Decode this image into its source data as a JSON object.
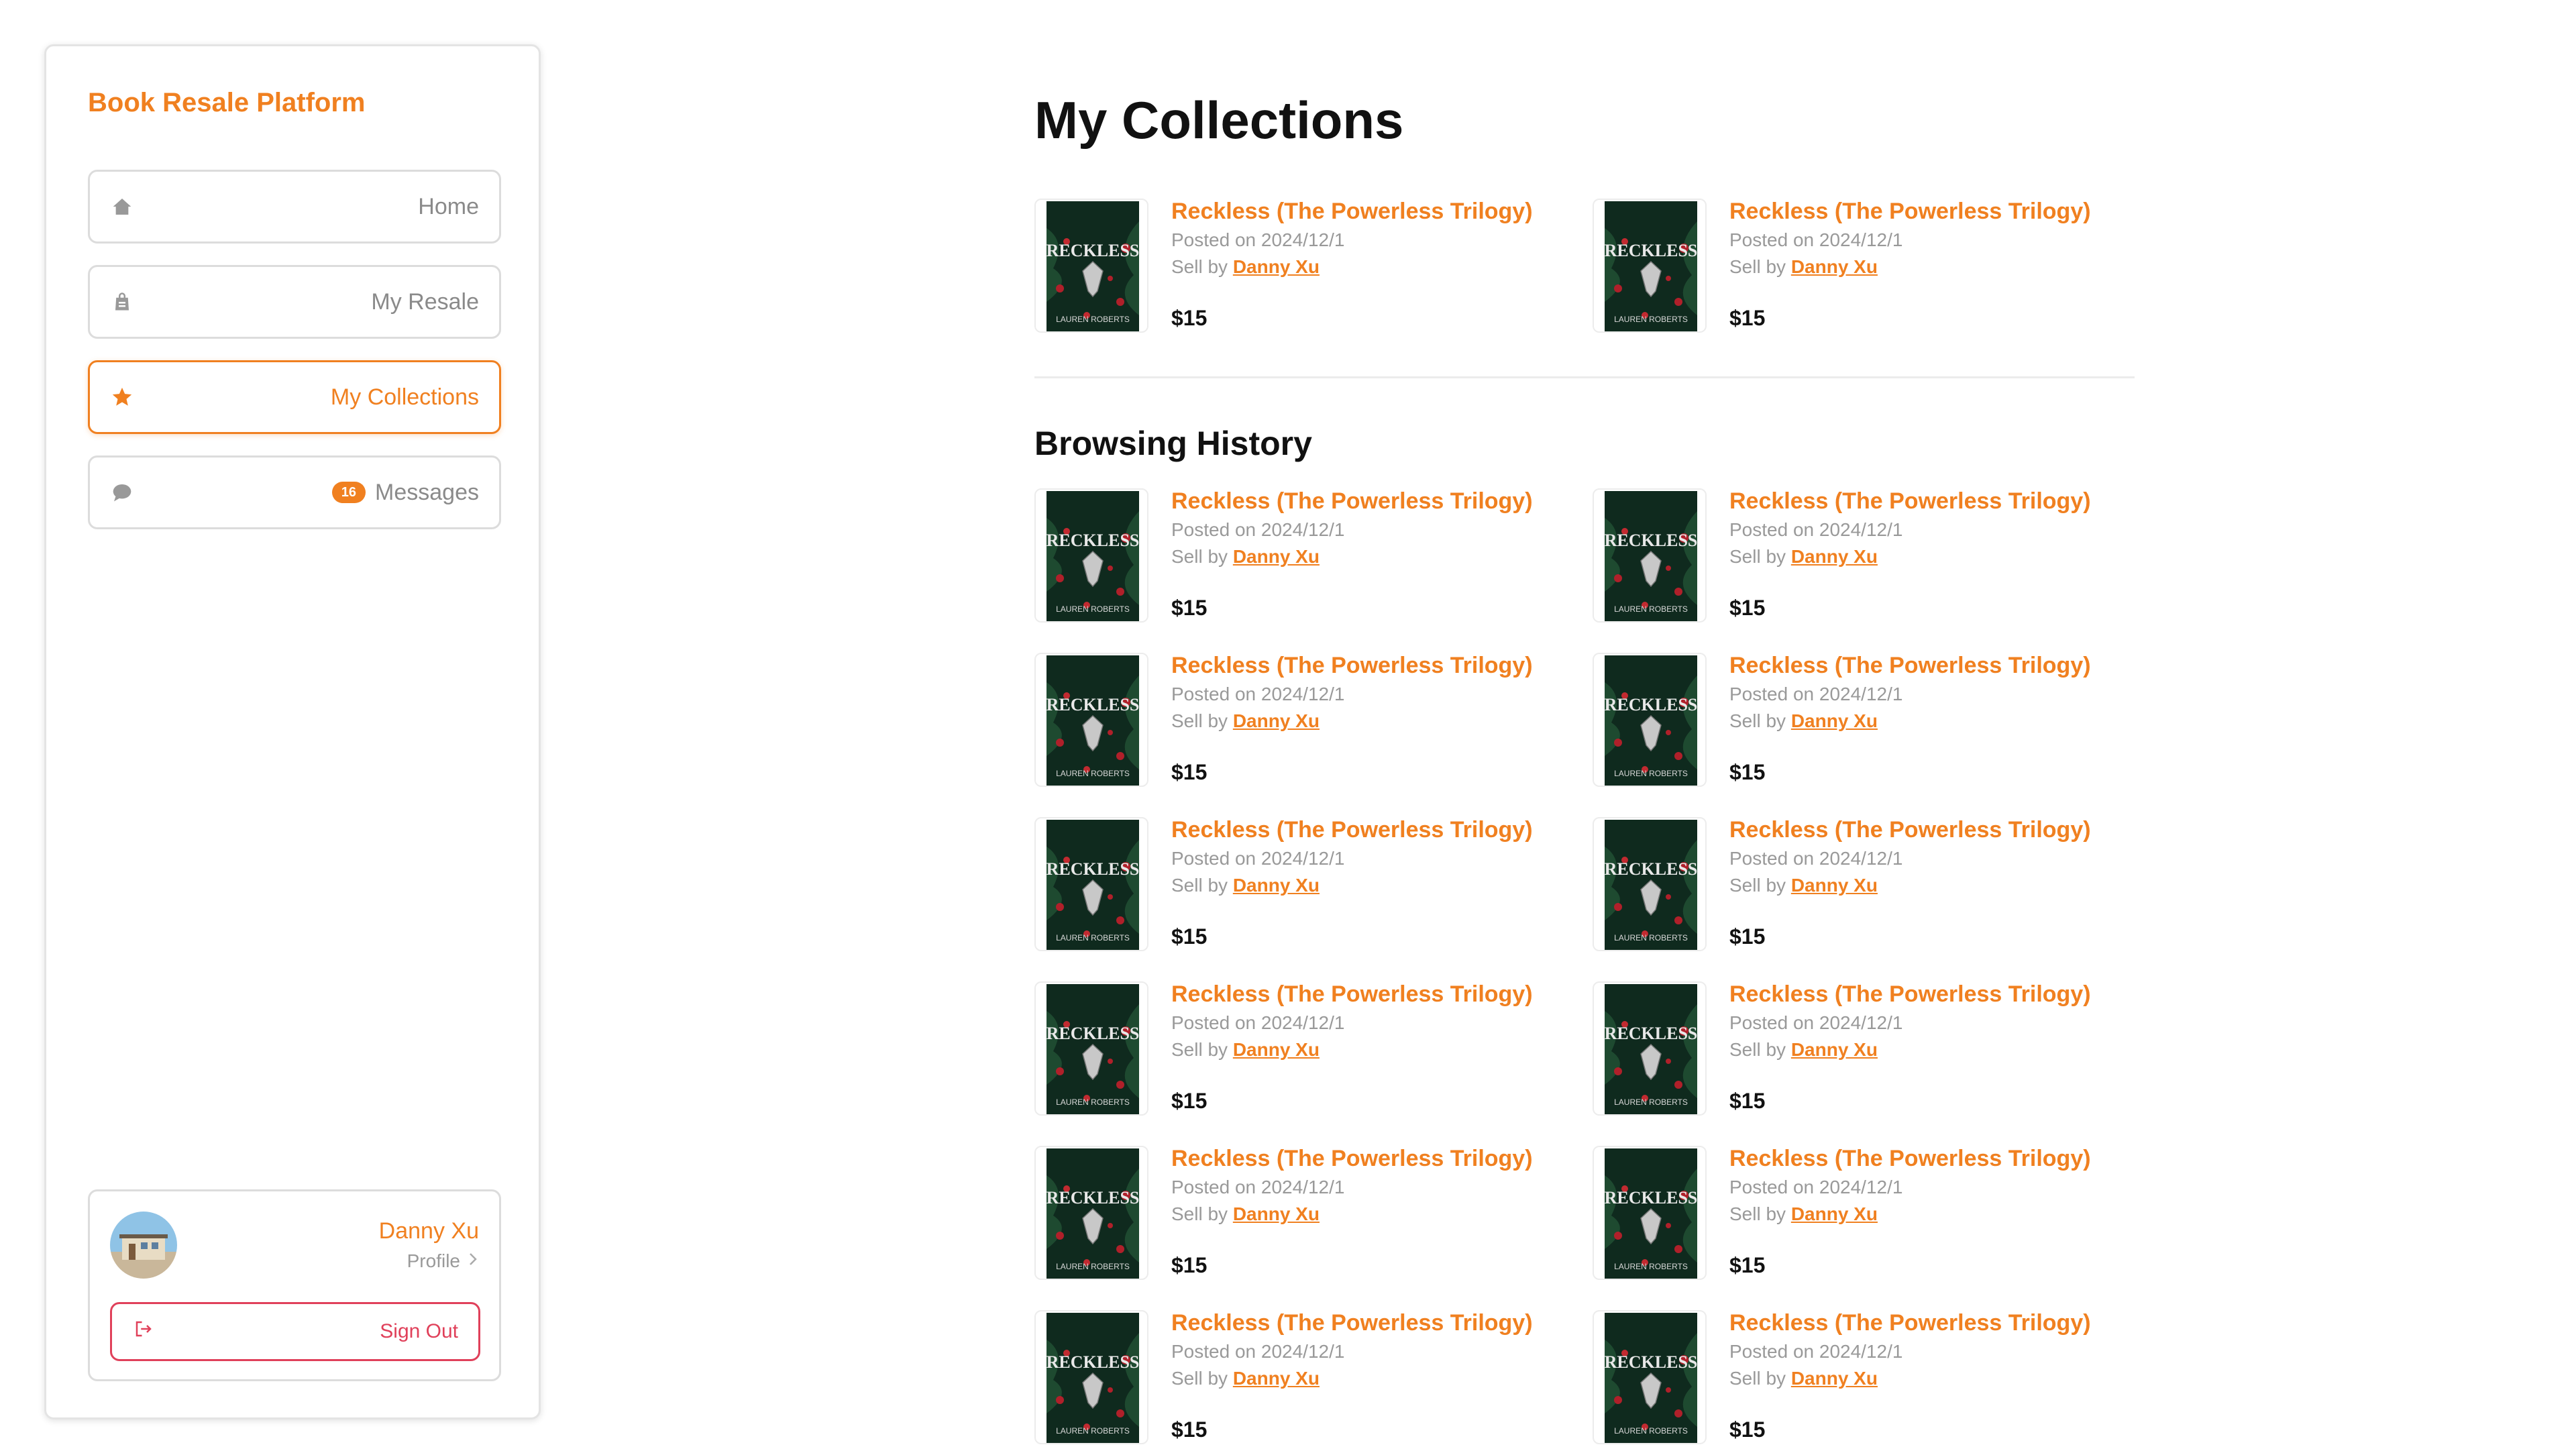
{
  "sidebar": {
    "brand": "Book Resale Platform",
    "nav": [
      {
        "label": "Home",
        "icon": "home-icon",
        "active": false
      },
      {
        "label": "My Resale",
        "icon": "bag-icon",
        "active": false
      },
      {
        "label": "My Collections",
        "icon": "star-icon",
        "active": true
      },
      {
        "label": "Messages",
        "icon": "chat-icon",
        "active": false,
        "badge": "16"
      }
    ],
    "user": {
      "name": "Danny Xu",
      "profile_label": "Profile",
      "signout_label": "Sign Out"
    }
  },
  "main": {
    "collections_title": "My Collections",
    "history_title": "Browsing History"
  },
  "colors": {
    "accent": "#f08020",
    "danger": "#e0405a",
    "muted": "#999999"
  },
  "book": {
    "title": "Reckless (The Powerless Trilogy)",
    "posted": "Posted on 2024/12/1",
    "seller_prefix": "Sell by ",
    "seller_name": "Danny Xu",
    "price": "$15",
    "cover_title": "RECKLESS",
    "cover_author": "LAUREN ROBERTS"
  },
  "collections_count": 2,
  "history_count": 12
}
